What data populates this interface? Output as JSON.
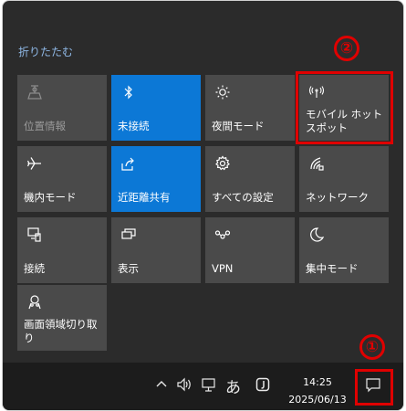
{
  "action_center": {
    "collapse_label": "折りたたむ",
    "tiles": [
      {
        "id": "location",
        "label": "位置情報",
        "icon": "location-icon",
        "state": "disabled"
      },
      {
        "id": "bluetooth",
        "label": "未接続",
        "icon": "bluetooth-icon",
        "state": "on"
      },
      {
        "id": "night-light",
        "label": "夜間モード",
        "icon": "brightness-icon",
        "state": "off"
      },
      {
        "id": "mobile-hotspot",
        "label": "モバイル ホットスポット",
        "icon": "hotspot-icon",
        "state": "off"
      },
      {
        "id": "airplane-mode",
        "label": "機内モード",
        "icon": "airplane-icon",
        "state": "off"
      },
      {
        "id": "nearby-sharing",
        "label": "近距離共有",
        "icon": "share-icon",
        "state": "on"
      },
      {
        "id": "all-settings",
        "label": "すべての設定",
        "icon": "gear-icon",
        "state": "off"
      },
      {
        "id": "network",
        "label": "ネットワーク",
        "icon": "network-icon",
        "state": "off"
      },
      {
        "id": "connect",
        "label": "接続",
        "icon": "connect-icon",
        "state": "off"
      },
      {
        "id": "project",
        "label": "表示",
        "icon": "project-icon",
        "state": "off"
      },
      {
        "id": "vpn",
        "label": "VPN",
        "icon": "vpn-icon",
        "state": "off"
      },
      {
        "id": "focus-assist",
        "label": "集中モード",
        "icon": "moon-icon",
        "state": "off"
      },
      {
        "id": "snip",
        "label": "画面領域切り取り",
        "icon": "snip-icon",
        "state": "off"
      }
    ]
  },
  "annotations": {
    "marker_1": "①",
    "marker_2": "②",
    "color": "#e00000"
  },
  "taskbar": {
    "ime_label": "あ",
    "time": "14:25",
    "date": "2025/06/13",
    "icons": [
      "chevron-up-icon",
      "volume-icon",
      "network-pc-icon",
      "ime-icon",
      "pen-icon",
      "notification-icon"
    ]
  },
  "colors": {
    "tile": "#4a4a4a",
    "tile_on": "#0c78d6",
    "background": "#2b2b2b",
    "taskbar": "#1c1c1c",
    "link": "#8fb8e6"
  }
}
